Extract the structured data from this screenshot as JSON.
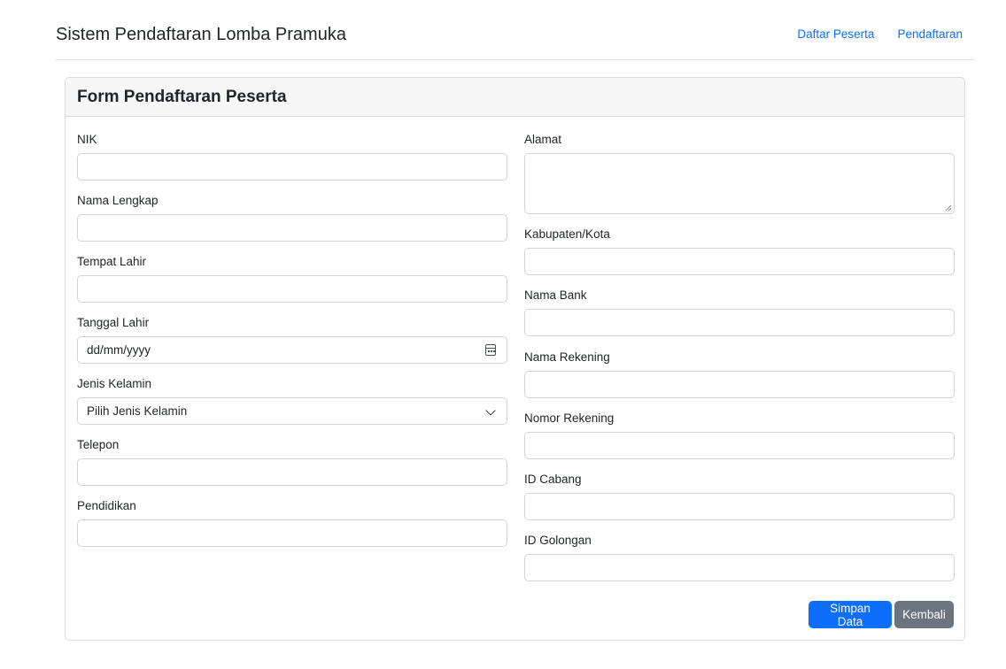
{
  "header": {
    "brand": "Sistem Pendaftaran Lomba Pramuka",
    "nav": [
      "Daftar Peserta",
      "Pendaftaran"
    ]
  },
  "card": {
    "title": "Form Pendaftaran Peserta"
  },
  "form": {
    "left": {
      "nik": {
        "label": "NIK",
        "value": ""
      },
      "nama": {
        "label": "Nama Lengkap",
        "value": ""
      },
      "tempat_lahir": {
        "label": "Tempat Lahir",
        "value": ""
      },
      "tanggal_lahir": {
        "label": "Tanggal Lahir",
        "placeholder": "dd/mm/yyyy",
        "icon": "calendar-icon"
      },
      "jenis_kelamin": {
        "label": "Jenis Kelamin",
        "selected": "Pilih Jenis Kelamin",
        "icon": "chevron-down-icon"
      },
      "telepon": {
        "label": "Telepon",
        "value": ""
      },
      "pendidikan": {
        "label": "Pendidikan",
        "value": ""
      }
    },
    "right": {
      "alamat": {
        "label": "Alamat",
        "value": ""
      },
      "kabupaten": {
        "label": "Kabupaten/Kota",
        "value": ""
      },
      "nama_bank": {
        "label": "Nama Bank",
        "value": ""
      },
      "nama_rekening": {
        "label": "Nama Rekening",
        "value": ""
      },
      "nomor_rekening": {
        "label": "Nomor Rekening",
        "value": ""
      },
      "id_cabang": {
        "label": "ID Cabang",
        "value": ""
      },
      "id_golongan": {
        "label": "ID Golongan",
        "value": ""
      }
    }
  },
  "actions": {
    "save_label": "Simpan Data",
    "back_label": "Kembali"
  },
  "colors": {
    "primary": "#0d6efd",
    "secondary": "#6c757d",
    "link": "#0d6efd"
  }
}
